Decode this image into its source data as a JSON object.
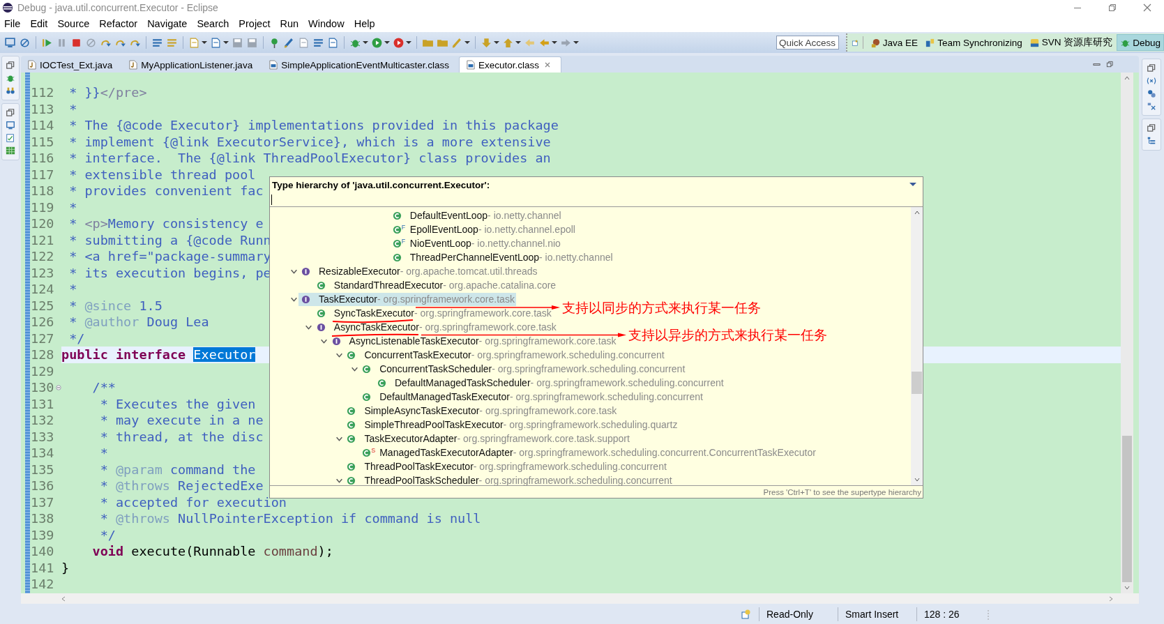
{
  "window": {
    "title": "Debug - java.util.concurrent.Executor - Eclipse"
  },
  "menu": [
    "File",
    "Edit",
    "Source",
    "Refactor",
    "Navigate",
    "Search",
    "Project",
    "Run",
    "Window",
    "Help"
  ],
  "quick_access": {
    "placeholder": "Quick Access"
  },
  "perspectives": [
    {
      "label": "Java EE",
      "selected": false
    },
    {
      "label": "Team Synchronizing",
      "selected": false
    },
    {
      "label": "SVN 资源库研究",
      "selected": false
    },
    {
      "label": "Debug",
      "selected": true
    }
  ],
  "editor_tabs": [
    {
      "label": "IOCTest_Ext.java",
      "kind": "java",
      "selected": false
    },
    {
      "label": "MyApplicationListener.java",
      "kind": "java",
      "selected": false
    },
    {
      "label": "SimpleApplicationEventMulticaster.class",
      "kind": "class",
      "selected": false
    },
    {
      "label": "Executor.class",
      "kind": "class",
      "selected": true
    }
  ],
  "editor": {
    "lines": [
      {
        "number": "112",
        "current": false,
        "segments": [
          {
            "text": " * }}",
            "kind": "comment"
          },
          {
            "text": "</pre>",
            "kind": "html"
          }
        ]
      },
      {
        "number": "113",
        "current": false,
        "segments": [
          {
            "text": " *",
            "kind": "comment"
          }
        ]
      },
      {
        "number": "114",
        "current": false,
        "segments": [
          {
            "text": " * The {@code Executor} implementations provided in this package",
            "kind": "comment"
          }
        ]
      },
      {
        "number": "115",
        "current": false,
        "segments": [
          {
            "text": " * implement {@link ExecutorService}, which is a more extensive",
            "kind": "comment"
          }
        ]
      },
      {
        "number": "116",
        "current": false,
        "segments": [
          {
            "text": " * interface.  The {@link ThreadPoolExecutor} class provides an",
            "kind": "comment"
          }
        ]
      },
      {
        "number": "117",
        "current": false,
        "segments": [
          {
            "text": " * extensible thread pool",
            "kind": "comment"
          }
        ]
      },
      {
        "number": "118",
        "current": false,
        "segments": [
          {
            "text": " * provides convenient fac",
            "kind": "comment"
          }
        ]
      },
      {
        "number": "119",
        "current": false,
        "segments": [
          {
            "text": " *",
            "kind": "comment"
          }
        ]
      },
      {
        "number": "120",
        "current": false,
        "segments": [
          {
            "text": " * ",
            "kind": "comment"
          },
          {
            "text": "<p>",
            "kind": "html"
          },
          {
            "text": "Memory consistency e",
            "kind": "comment"
          }
        ]
      },
      {
        "number": "121",
        "current": false,
        "segments": [
          {
            "text": " * submitting a {@code Runn",
            "kind": "comment"
          }
        ]
      },
      {
        "number": "122",
        "current": false,
        "segments": [
          {
            "text": " * <a href=\"package-summary",
            "kind": "comment"
          }
        ]
      },
      {
        "number": "123",
        "current": false,
        "segments": [
          {
            "text": " * its execution begins, pe",
            "kind": "comment"
          }
        ]
      },
      {
        "number": "124",
        "current": false,
        "segments": [
          {
            "text": " *",
            "kind": "comment"
          }
        ]
      },
      {
        "number": "125",
        "current": false,
        "segments": [
          {
            "text": " * ",
            "kind": "comment"
          },
          {
            "text": "@since",
            "kind": "doctag"
          },
          {
            "text": " 1.5",
            "kind": "comment"
          }
        ]
      },
      {
        "number": "126",
        "current": false,
        "segments": [
          {
            "text": " * ",
            "kind": "comment"
          },
          {
            "text": "@author",
            "kind": "doctag"
          },
          {
            "text": " Doug Lea",
            "kind": "comment"
          }
        ]
      },
      {
        "number": "127",
        "current": false,
        "segments": [
          {
            "text": " */",
            "kind": "comment"
          }
        ]
      },
      {
        "number": "128",
        "current": true,
        "segments": [
          {
            "text": "public interface ",
            "kind": "keyword"
          },
          {
            "text": "Executor",
            "kind": "selected"
          }
        ]
      },
      {
        "number": "129",
        "current": false
      },
      {
        "number": "130",
        "current": false,
        "segments": [
          {
            "text": "    /**",
            "kind": "comment"
          }
        ]
      },
      {
        "number": "131",
        "current": false,
        "segments": [
          {
            "text": "     * Executes the given",
            "kind": "comment"
          }
        ]
      },
      {
        "number": "132",
        "current": false,
        "segments": [
          {
            "text": "     * may execute in a ne",
            "kind": "comment"
          }
        ]
      },
      {
        "number": "133",
        "current": false,
        "segments": [
          {
            "text": "     * thread, at the disc",
            "kind": "comment"
          }
        ]
      },
      {
        "number": "134",
        "current": false,
        "segments": [
          {
            "text": "     *",
            "kind": "comment"
          }
        ]
      },
      {
        "number": "135",
        "current": false,
        "segments": [
          {
            "text": "     * ",
            "kind": "comment"
          },
          {
            "text": "@param",
            "kind": "doctag"
          },
          {
            "text": " command the",
            "kind": "comment"
          }
        ]
      },
      {
        "number": "136",
        "current": false,
        "segments": [
          {
            "text": "     * ",
            "kind": "comment"
          },
          {
            "text": "@throws",
            "kind": "doctag"
          },
          {
            "text": " RejectedExe",
            "kind": "comment"
          }
        ]
      },
      {
        "number": "137",
        "current": false,
        "segments": [
          {
            "text": "     * accepted for execution",
            "kind": "comment"
          }
        ]
      },
      {
        "number": "138",
        "current": false,
        "segments": [
          {
            "text": "     * ",
            "kind": "comment"
          },
          {
            "text": "@throws",
            "kind": "doctag"
          },
          {
            "text": " NullPointerException if command is null",
            "kind": "comment"
          }
        ]
      },
      {
        "number": "139",
        "current": false,
        "segments": [
          {
            "text": "     */",
            "kind": "comment"
          }
        ]
      },
      {
        "number": "140",
        "current": false,
        "segments": [
          {
            "text": "    void",
            "kind": "keyword"
          },
          {
            "text": " execute(Runnable ",
            "kind": "plain"
          },
          {
            "text": "command",
            "kind": "param"
          },
          {
            "text": ");",
            "kind": "plain"
          }
        ]
      },
      {
        "number": "141",
        "current": false,
        "segments": [
          {
            "text": "}",
            "kind": "plain"
          }
        ]
      },
      {
        "number": "142",
        "current": false
      }
    ]
  },
  "type_hierarchy": {
    "title": "Type hierarchy of 'java.util.concurrent.Executor':",
    "tree": [
      {
        "children": [
          {
            "children": [
              {
                "children": [
                  {
                    "children": [
                      {
                        "children": [
                          {
                            "children": [
                              {
                                "name": "DefaultEventLoop",
                                "package_label": "- io.netty.channel",
                                "kind": "class",
                                "selected": false
                              },
                              {
                                "name": "EpollEventLoop",
                                "package_label": "- io.netty.channel.epoll",
                                "kind": "class",
                                "badge": "F",
                                "selected": false
                              },
                              {
                                "name": "NioEventLoop",
                                "package_label": "- io.netty.channel.nio",
                                "kind": "class",
                                "badge": "F",
                                "selected": false
                              },
                              {
                                "name": "ThreadPerChannelEventLoop",
                                "package_label": "- io.netty.channel",
                                "kind": "class",
                                "selected": false
                              }
                            ]
                          }
                        ]
                      }
                    ]
                  }
                ]
              }
            ]
          }
        ]
      },
      {
        "name": "ResizableExecutor",
        "package_label": "- org.apache.tomcat.util.threads",
        "kind": "interface",
        "expanded": true,
        "selected": false,
        "children": [
          {
            "name": "StandardThreadExecutor",
            "package_label": "- org.apache.catalina.core",
            "kind": "class",
            "selected": false
          }
        ]
      },
      {
        "name": "TaskExecutor",
        "package_label": "- org.springframework.core.task",
        "kind": "interface",
        "expanded": true,
        "selected": true,
        "children": [
          {
            "name": "SyncTaskExecutor",
            "package_label": "- org.springframework.core.task",
            "kind": "class",
            "selected": false
          },
          {
            "name": "AsyncTaskExecutor",
            "package_label": "- org.springframework.core.task",
            "kind": "interface",
            "expanded": true,
            "selected": false,
            "children": [
              {
                "name": "AsyncListenableTaskExecutor",
                "package_label": "- org.springframework.core.task",
                "kind": "interface",
                "expanded": true,
                "selected": false,
                "children": [
                  {
                    "name": "ConcurrentTaskExecutor",
                    "package_label": "- org.springframework.scheduling.concurrent",
                    "kind": "class",
                    "expanded": true,
                    "selected": false,
                    "children": [
                      {
                        "name": "ConcurrentTaskScheduler",
                        "package_label": "- org.springframework.scheduling.concurrent",
                        "kind": "class",
                        "expanded": true,
                        "selected": false,
                        "children": [
                          {
                            "name": "DefaultManagedTaskScheduler",
                            "package_label": "- org.springframework.scheduling.concurrent",
                            "kind": "class",
                            "selected": false
                          }
                        ]
                      },
                      {
                        "name": "DefaultManagedTaskExecutor",
                        "package_label": "- org.springframework.scheduling.concurrent",
                        "kind": "class",
                        "selected": false
                      }
                    ]
                  },
                  {
                    "name": "SimpleAsyncTaskExecutor",
                    "package_label": "- org.springframework.core.task",
                    "kind": "class",
                    "selected": false
                  },
                  {
                    "name": "SimpleThreadPoolTaskExecutor",
                    "package_label": "- org.springframework.scheduling.quartz",
                    "kind": "class",
                    "selected": false
                  },
                  {
                    "name": "TaskExecutorAdapter",
                    "package_label": "- org.springframework.core.task.support",
                    "kind": "class",
                    "expanded": true,
                    "selected": false,
                    "children": [
                      {
                        "name": "ManagedTaskExecutorAdapter",
                        "package_label": "- org.springframework.scheduling.concurrent.ConcurrentTaskExecutor",
                        "kind": "class",
                        "badge": "S",
                        "selected": false
                      }
                    ]
                  },
                  {
                    "name": "ThreadPoolTaskExecutor",
                    "package_label": "- org.springframework.scheduling.concurrent",
                    "kind": "class",
                    "selected": false
                  },
                  {
                    "name": "ThreadPoolTaskScheduler",
                    "package_label": "- org.springframework.scheduling.concurrent",
                    "kind": "class",
                    "expanded": true,
                    "selected": false
                  }
                ]
              }
            ]
          }
        ]
      }
    ],
    "footer": "Press 'Ctrl+T' to see the supertype hierarchy"
  },
  "annotations": [
    {
      "text": "支持以同步的方式来执行某一任务"
    },
    {
      "text": "支持以异步的方式来执行某一任务"
    }
  ],
  "status_bar": {
    "mode": "Read-Only",
    "insert_mode": "Smart Insert",
    "position": "128 : 26"
  }
}
